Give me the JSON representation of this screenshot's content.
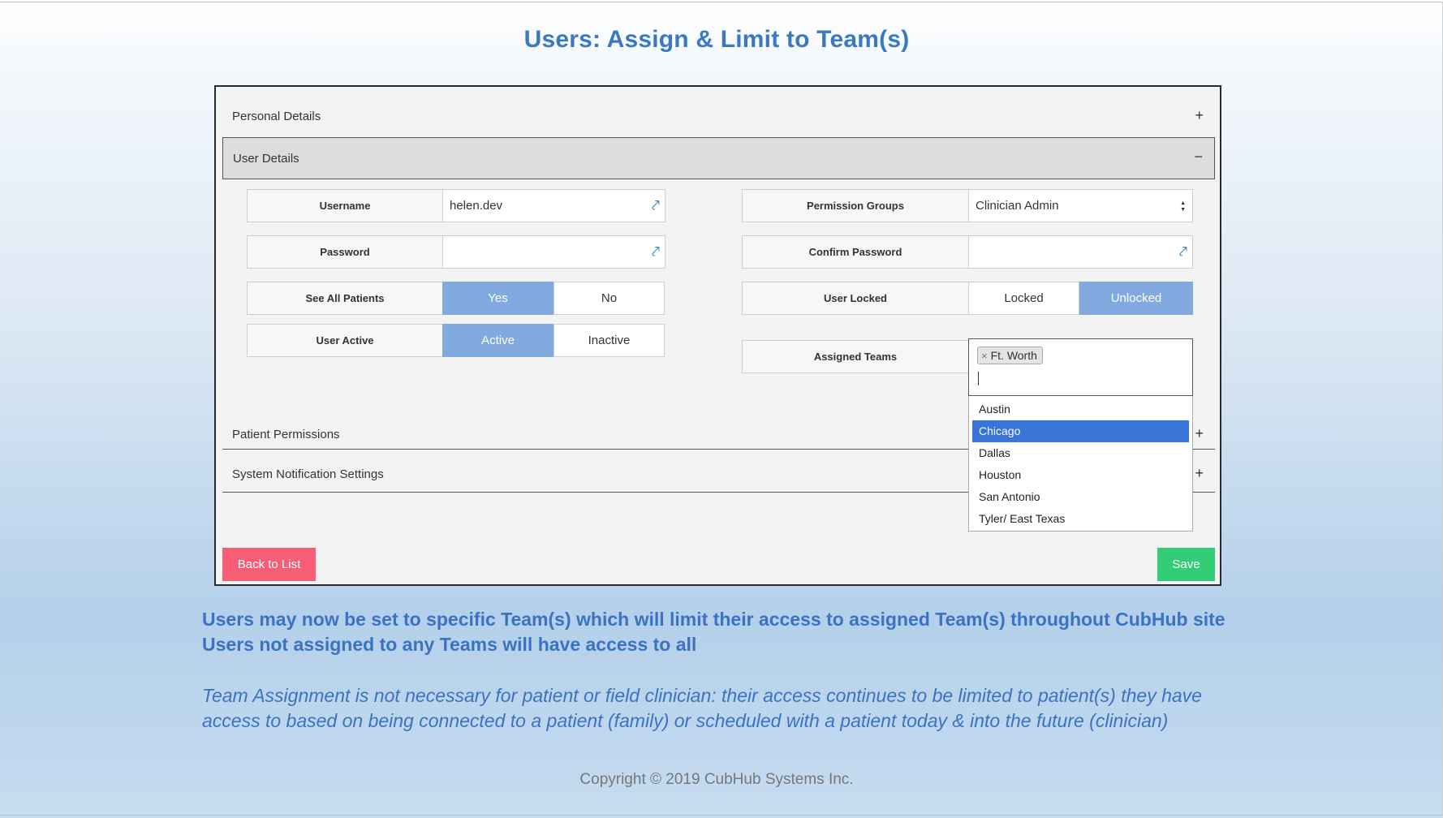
{
  "slide": {
    "title": "Users: Assign & Limit to Team(s)",
    "note_line1": "Users may now be set to specific Team(s) which will limit their access to assigned Team(s) throughout CubHub site",
    "note_line2": "Users not assigned to any Teams will have access to all",
    "italic_line1": "Team Assignment is not necessary for patient or field clinician: their access continues to be limited to patient(s) they have",
    "italic_line2": "access to based on being connected to a patient (family) or scheduled with a patient today & into the future (clinician)",
    "copyright": "Copyright © 2019 CubHub Systems Inc."
  },
  "sections": {
    "personal_details": {
      "label": "Personal Details",
      "toggle": "+"
    },
    "user_details": {
      "label": "User Details",
      "toggle": "−"
    },
    "patient_permissions": {
      "label": "Patient Permissions",
      "toggle": "+"
    },
    "system_notification_settings": {
      "label": "System Notification Settings",
      "toggle": "+"
    }
  },
  "form": {
    "username": {
      "label": "Username",
      "value": "helen.dev",
      "icon": "key-icon"
    },
    "password": {
      "label": "Password",
      "value": "",
      "icon": "key-icon"
    },
    "see_all_patients": {
      "label": "See All Patients",
      "options": [
        "Yes",
        "No"
      ],
      "selected": "Yes"
    },
    "user_active": {
      "label": "User Active",
      "options": [
        "Active",
        "Inactive"
      ],
      "selected": "Active"
    },
    "permission_groups": {
      "label": "Permission Groups",
      "value": "Clinician Admin",
      "arrow_up": "▲",
      "arrow_down": "▼"
    },
    "confirm_password": {
      "label": "Confirm Password",
      "value": "",
      "icon": "key-icon"
    },
    "user_locked": {
      "label": "User Locked",
      "options": [
        "Locked",
        "Unlocked"
      ],
      "selected": "Unlocked"
    },
    "assigned_teams": {
      "label": "Assigned Teams",
      "selected_chips": [
        "Ft. Worth"
      ],
      "chip_remove": "×",
      "options": [
        "Austin",
        "Chicago",
        "Dallas",
        "Houston",
        "San Antonio",
        "Tyler/ East Texas"
      ],
      "highlighted": "Chicago"
    }
  },
  "buttons": {
    "back_to_list": "Back to List",
    "save": "Save"
  },
  "key_glyph": "⤤",
  "colors": {
    "title_blue": "#3b78c4",
    "toggle_on": "#82a9e0",
    "highlight": "#3875d7",
    "back_button": "#f85d76",
    "save_button": "#33cc77"
  }
}
